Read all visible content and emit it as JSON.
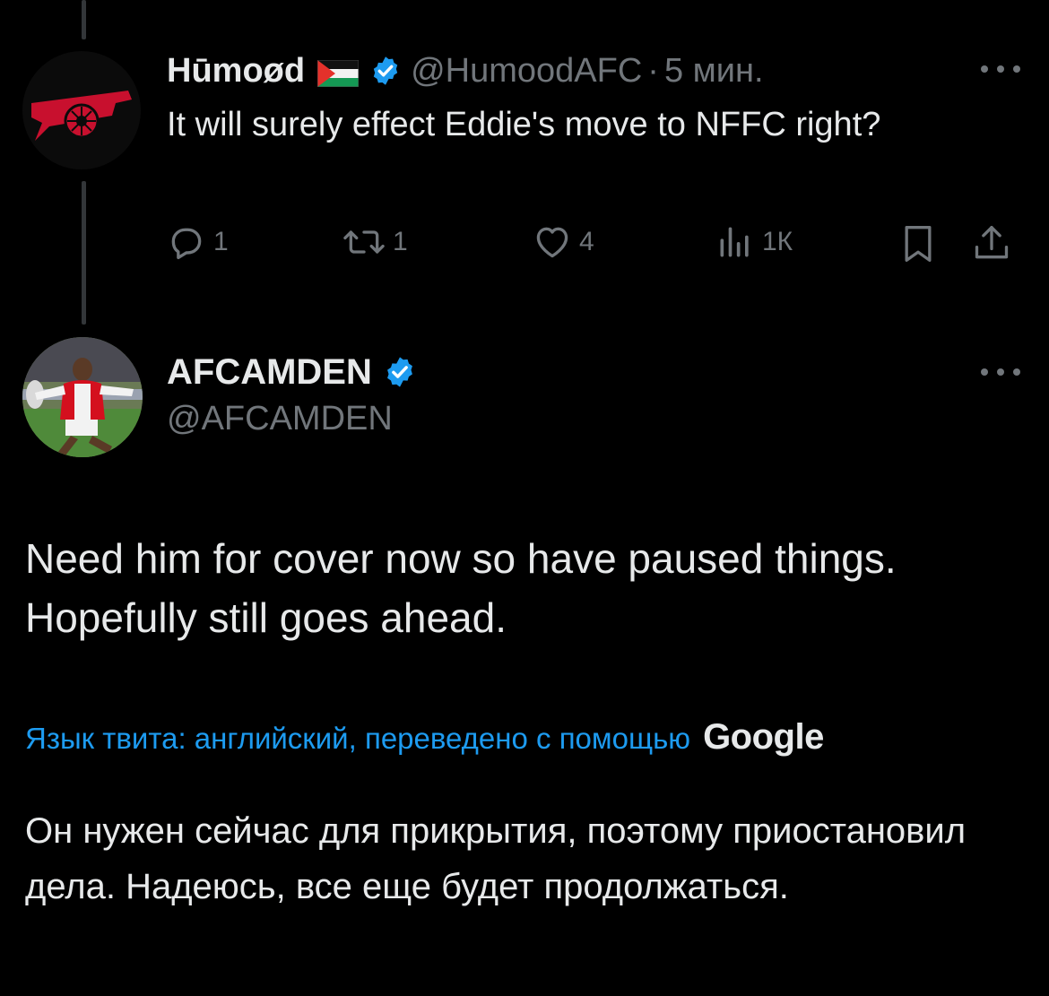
{
  "reply_tweet": {
    "display_name": "Hūmoød",
    "handle": "@HumoodAFC",
    "separator": "·",
    "time": "5 мин.",
    "text": "It will surely effect Eddie's move to NFFC right?",
    "actions": {
      "replies": "1",
      "retweets": "1",
      "likes": "4",
      "views": "1К"
    }
  },
  "main_tweet": {
    "display_name": "AFCAMDEN",
    "handle": "@AFCAMDEN",
    "text": "Need him for cover now so have paused things. Hopefully still goes ahead.",
    "translation_label": "Язык твита: английский, переведено с помощью",
    "translation_provider": "Google",
    "translated_text": "Он нужен сейчас для прикрытия, поэтому приостановил дела. Надеюсь, все еще будет продолжаться."
  },
  "colors": {
    "background": "#000000",
    "text_primary": "#e7e9ea",
    "text_secondary": "#71767b",
    "accent": "#1d9bf0",
    "verified": "#1d9bf0"
  },
  "icons": [
    "avatar-arsenal-cannon",
    "palestine-flag-icon",
    "verified-badge-icon",
    "more-icon",
    "reply-icon",
    "retweet-icon",
    "like-icon",
    "views-icon",
    "bookmark-icon",
    "share-icon"
  ]
}
